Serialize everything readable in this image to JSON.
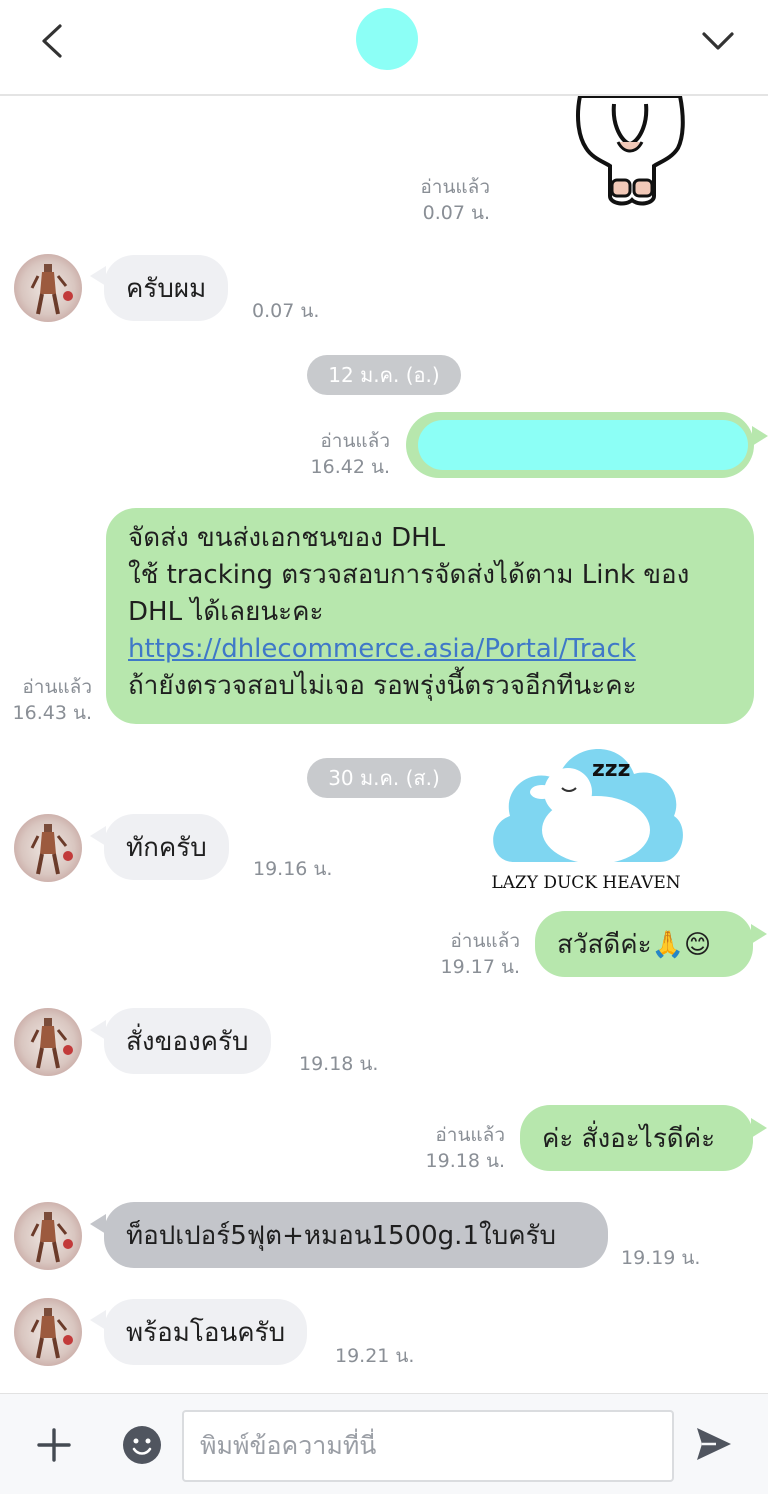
{
  "colors": {
    "incoming_bubble": "#eff0f3",
    "incoming_bubble_highlight": "#c3c5ca",
    "outgoing_bubble": "#b7e7ad",
    "redaction": "#8cfff6",
    "link": "#3f78c8"
  },
  "header": {
    "back_icon": "chevron-left-icon",
    "menu_icon": "chevron-down-icon"
  },
  "messages": {
    "top_read": "อ่านแล้ว",
    "top_time": "0.07 น.",
    "m1_text": "ครับผม",
    "m1_time": "0.07 น.",
    "date1": "12 ม.ค. (อ.)",
    "m2_read": "อ่านแล้ว",
    "m2_time": "16.42 น.",
    "m3_line1": "จัดส่ง ขนส่งเอกชนของ DHL",
    "m3_line2": "ใช้ tracking ตรวจสอบการจัดส่งได้ตาม Link ของ",
    "m3_line3": "DHL ได้เลยนะคะ",
    "m3_link": "https://dhlecommerce.asia/Portal/Track",
    "m3_line5": "ถ้ายังตรวจสอบไม่เจอ รอพรุ่งนี้ตรวจอีกทีนะคะ",
    "m3_read": "อ่านแล้ว",
    "m3_time": "16.43 น.",
    "date2": "30 ม.ค. (ส.)",
    "m4_text": "ทักครับ",
    "m4_time": "19.16 น.",
    "sticker_caption": "LAZY DUCK HEAVEN",
    "sticker_zzz": "zzz",
    "m5_text": "สวัสดีค่ะ🙏😊",
    "m5_read": "อ่านแล้ว",
    "m5_time": "19.17 น.",
    "m6_text": "สั่งของครับ",
    "m6_time": "19.18 น.",
    "m7_text": "ค่ะ สั่งอะไรดีค่ะ",
    "m7_read": "อ่านแล้ว",
    "m7_time": "19.18 น.",
    "m8_text": "ท็อปเปอร์5ฟุต+หมอน1500g.1ใบครับ",
    "m8_time": "19.19 น.",
    "m9_text": "พร้อมโอนครับ",
    "m9_time": "19.21 น."
  },
  "footer": {
    "input_placeholder": "พิมพ์ข้อความที่นี่",
    "add_icon": "plus-icon",
    "emoji_icon": "emoji-icon",
    "send_icon": "send-icon"
  }
}
